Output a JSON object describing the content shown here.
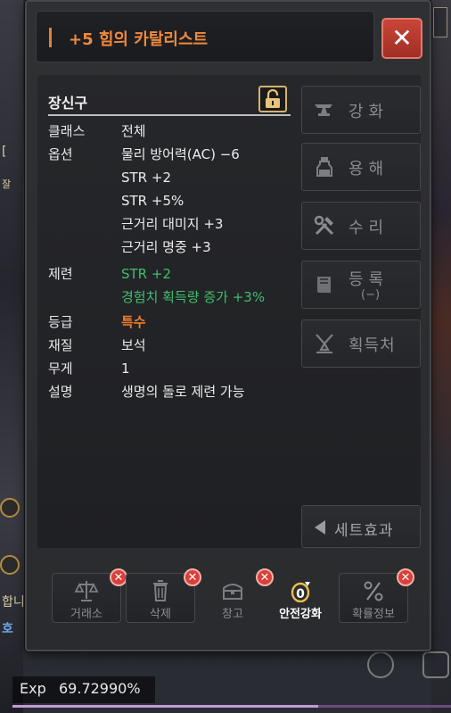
{
  "window": {
    "title": "+5 힘의 카탈리스트",
    "close_label": "✕"
  },
  "item": {
    "type": "장신구",
    "rows": [
      {
        "label": "클래스",
        "value": "전체"
      },
      {
        "label": "옵션",
        "value": "물리 방어력(AC) −6"
      },
      {
        "label": "",
        "value": "STR +2"
      },
      {
        "label": "",
        "value": "STR +5%"
      },
      {
        "label": "",
        "value": "근거리 대미지 +3"
      },
      {
        "label": "",
        "value": "근거리 명중 +3"
      },
      {
        "label": "제련",
        "value": "STR +2"
      },
      {
        "label": "",
        "value": "경험치 획득량 증가 +3%"
      },
      {
        "label": "등급",
        "value": "특수"
      },
      {
        "label": "재질",
        "value": "보석"
      },
      {
        "label": "무게",
        "value": "1"
      },
      {
        "label": "설명",
        "value": "생명의 돌로 제련 가능"
      }
    ],
    "colors": {
      "refine": "#3fbf6b",
      "grade": "#f07b2e",
      "title": "#ef8a3e"
    }
  },
  "side_buttons": [
    {
      "label": "강화",
      "icon": "anvil-icon"
    },
    {
      "label": "용해",
      "icon": "potion-bottle-icon"
    },
    {
      "label": "수리",
      "icon": "tools-icon"
    },
    {
      "label": "등록",
      "sub": "(−)",
      "icon": "book-icon"
    },
    {
      "label": "획득처",
      "icon": "acquire-icon"
    }
  ],
  "set_button": {
    "label": "세트효과",
    "icon": "left-triangle-icon"
  },
  "bottom_buttons": [
    {
      "label": "거래소",
      "icon": "scale-icon"
    },
    {
      "label": "삭제",
      "icon": "trash-icon"
    },
    {
      "label": "창고",
      "icon": "chest-icon"
    },
    {
      "label": "안전강화",
      "icon": "safe-enhance-icon"
    },
    {
      "label": "확률정보",
      "icon": "percent-icon"
    }
  ],
  "badge_x": "✕",
  "exp": {
    "label": "Exp",
    "value": "69.72990%",
    "fraction": 0.6973
  },
  "background": {
    "left_fragments": [
      "[",
      "잘",
      "합니",
      "호"
    ]
  }
}
